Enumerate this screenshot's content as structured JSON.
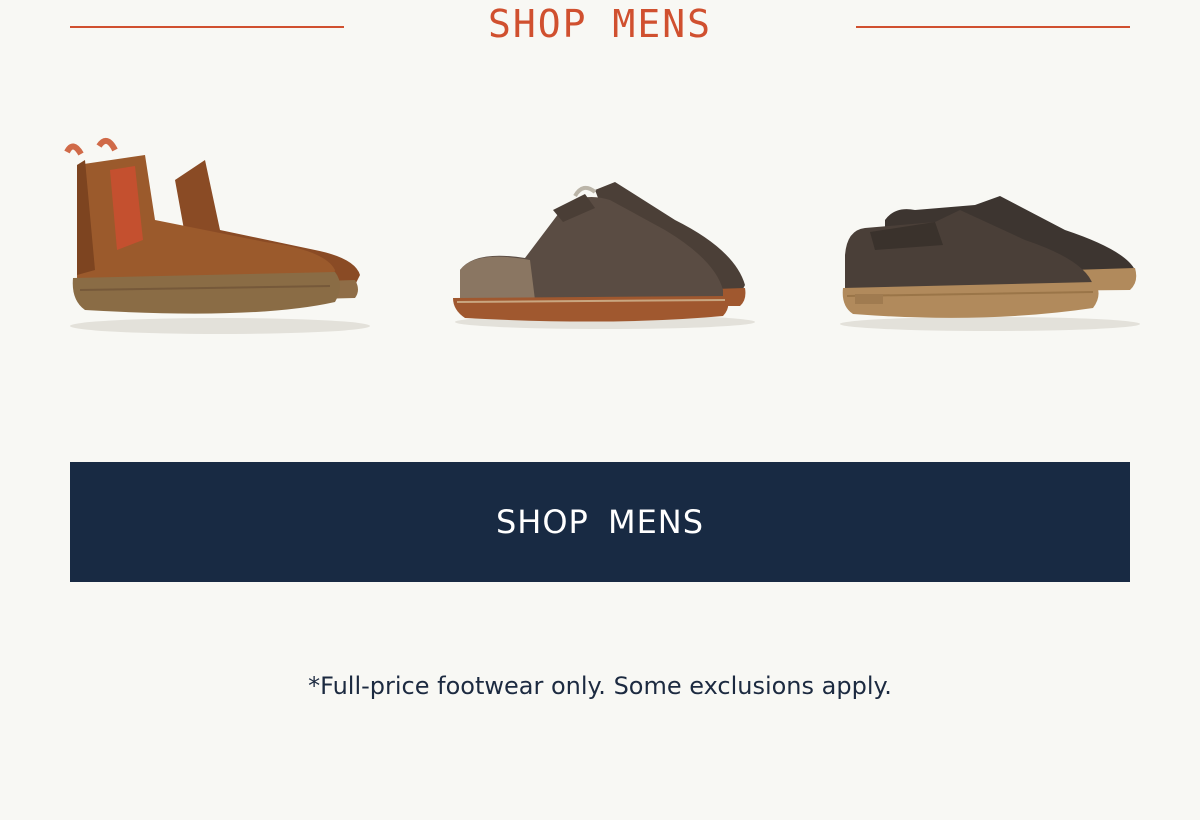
{
  "header": {
    "title": "SHOP MENS"
  },
  "products": [
    {
      "icon": "chelsea-boot-image"
    },
    {
      "icon": "mule-slide-image"
    },
    {
      "icon": "slip-on-sneaker-image"
    }
  ],
  "cta": {
    "label": "SHOP  MENS"
  },
  "footer": {
    "disclaimer": "*Full-price footwear only. Some exclusions apply."
  },
  "colors": {
    "accent": "#d0502f",
    "button_bg": "#182a43",
    "page_bg": "#f8f8f4",
    "text": "#1c2a40"
  }
}
